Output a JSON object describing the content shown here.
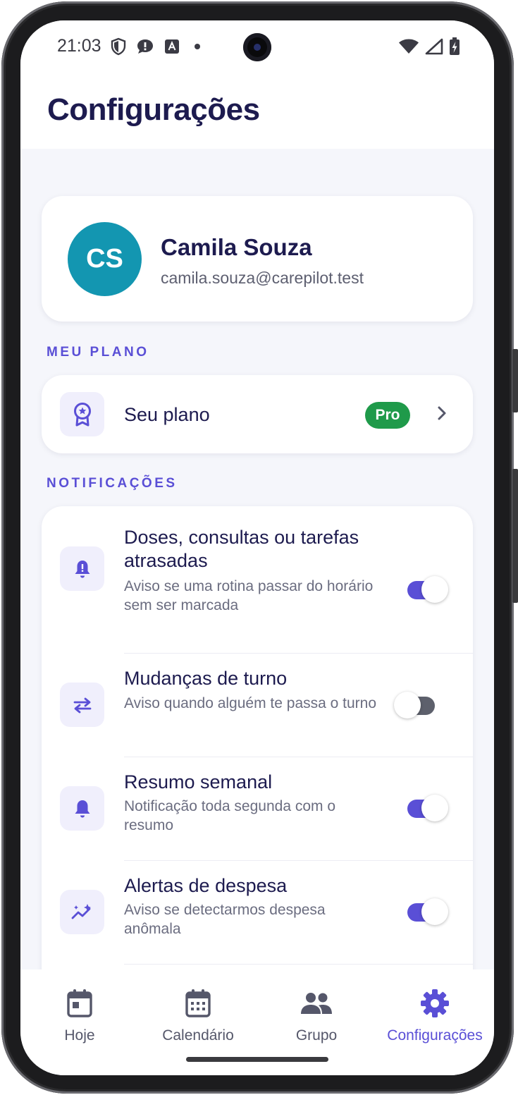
{
  "status_bar": {
    "time": "21:03",
    "left_icons": [
      "shield-icon",
      "chat-alert-icon",
      "a-badge-icon",
      "dot-icon"
    ],
    "right_icons": [
      "wifi-icon",
      "signal-icon",
      "battery-charging-icon"
    ]
  },
  "header": {
    "title": "Configurações"
  },
  "profile": {
    "initials": "CS",
    "name": "Camila Souza",
    "email": "camila.souza@carepilot.test",
    "avatar_color": "#1396b1"
  },
  "plan_section": {
    "label": "MEU PLANO",
    "item": {
      "title": "Seu plano",
      "badge": "Pro",
      "icon": "award-icon"
    }
  },
  "notifications_section": {
    "label": "NOTIFICAÇÕES",
    "items": [
      {
        "title": "Doses, consultas ou tarefas atrasadas",
        "description": "Aviso se uma rotina passar do horário sem ser marcada",
        "enabled": true,
        "icon": "bell-alert-icon"
      },
      {
        "title": "Mudanças de turno",
        "description": "Aviso quando alguém te passa o turno",
        "enabled": false,
        "icon": "swap-arrows-icon"
      },
      {
        "title": "Resumo semanal",
        "description": "Notificação toda segunda com o resumo",
        "enabled": true,
        "icon": "bell-icon"
      },
      {
        "title": "Alertas de despesa",
        "description": "Aviso se detectarmos despesa anômala",
        "enabled": true,
        "icon": "trend-sparkle-icon"
      }
    ]
  },
  "bottom_nav": {
    "items": [
      {
        "label": "Hoje",
        "icon": "calendar-day-icon",
        "active": false
      },
      {
        "label": "Calendário",
        "icon": "calendar-month-icon",
        "active": false
      },
      {
        "label": "Grupo",
        "icon": "group-icon",
        "active": false
      },
      {
        "label": "Configurações",
        "icon": "gear-icon",
        "active": true
      }
    ]
  },
  "colors": {
    "accent": "#5a4fd6",
    "title": "#1d1b4f",
    "pro_badge": "#1f9a4a",
    "background": "#f5f6fb"
  }
}
